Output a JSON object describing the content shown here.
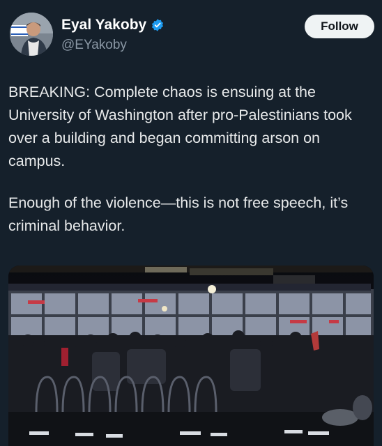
{
  "tweet": {
    "author_name": "Eyal Yakoby",
    "author_handle": "@EYakoby",
    "verified": true,
    "follow_label": "Follow",
    "paragraphs": [
      "BREAKING: Complete chaos is ensuing at the University of Washington after pro-Palestinians took over a building and began committing arson on campus.",
      "Enough of the violence—this is not free speech, it’s criminal behavior."
    ]
  },
  "colors": {
    "background": "#15202b",
    "text_primary": "#e7e9ea",
    "text_secondary": "#8b98a5",
    "verified_blue": "#1d9bf0",
    "follow_bg": "#eff3f4"
  },
  "icons": {
    "verified": "verified-badge-icon"
  }
}
